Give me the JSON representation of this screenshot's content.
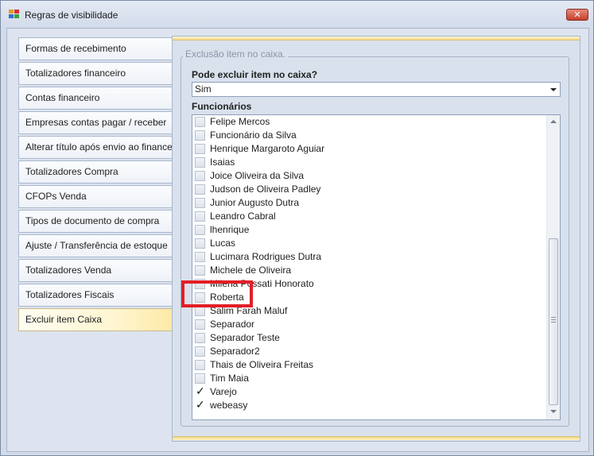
{
  "window": {
    "title": "Regras de visibilidade",
    "close_glyph": "✕"
  },
  "tabs": [
    {
      "label": "Formas de recebimento",
      "active": false
    },
    {
      "label": "Totalizadores financeiro",
      "active": false
    },
    {
      "label": "Contas financeiro",
      "active": false
    },
    {
      "label": "Empresas contas pagar / receber",
      "active": false
    },
    {
      "label": "Alterar título após envio ao financeiro",
      "active": false
    },
    {
      "label": "Totalizadores Compra",
      "active": false
    },
    {
      "label": "CFOPs Venda",
      "active": false
    },
    {
      "label": "Tipos de documento de compra",
      "active": false
    },
    {
      "label": "Ajuste / Transferência de estoque",
      "active": false
    },
    {
      "label": "Totalizadores Venda",
      "active": false
    },
    {
      "label": "Totalizadores Fiscais",
      "active": false
    },
    {
      "label": "Excluir item Caixa",
      "active": true
    }
  ],
  "group": {
    "title": "Exclusão item no caixa.",
    "question_label": "Pode excluir item no caixa?",
    "select_value": "Sim",
    "list_label": "Funcionários"
  },
  "employees": [
    {
      "name": "Felipe Mercos",
      "checked": false
    },
    {
      "name": "Funcionário da Silva",
      "checked": false
    },
    {
      "name": "Henrique Margaroto Aguiar",
      "checked": false
    },
    {
      "name": "Isaias",
      "checked": false
    },
    {
      "name": "Joice Oliveira da Silva",
      "checked": false
    },
    {
      "name": "Judson de Oliveira Padley",
      "checked": false
    },
    {
      "name": "Junior Augusto Dutra",
      "checked": false
    },
    {
      "name": "Leandro Cabral",
      "checked": false
    },
    {
      "name": "lhenrique",
      "checked": false
    },
    {
      "name": "Lucas",
      "checked": false
    },
    {
      "name": "Lucimara Rodrigues Dutra",
      "checked": false
    },
    {
      "name": "Michele de Oliveira",
      "checked": false
    },
    {
      "name": "Milena Possati Honorato",
      "checked": false
    },
    {
      "name": "Roberta",
      "checked": false
    },
    {
      "name": "Salim Farah Maluf",
      "checked": false
    },
    {
      "name": "Separador",
      "checked": false
    },
    {
      "name": "Separador Teste",
      "checked": false
    },
    {
      "name": "Separador2",
      "checked": false
    },
    {
      "name": "Thais de Oliveira Freitas",
      "checked": false
    },
    {
      "name": "Tim Maia",
      "checked": false
    },
    {
      "name": "Varejo",
      "checked": true
    },
    {
      "name": "webeasy",
      "checked": true
    }
  ],
  "colors": {
    "highlight": "#e21e26",
    "active_tab": "#fde9a6"
  }
}
